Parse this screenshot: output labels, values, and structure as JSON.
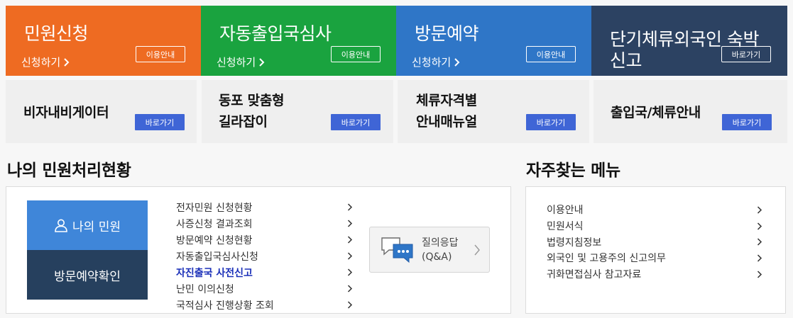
{
  "top_tiles": [
    {
      "title": "민원신청",
      "sub": "신청하기",
      "button": "이용안내",
      "color": "#ee6b22"
    },
    {
      "title": "자동출입국심사",
      "sub": "신청하기",
      "button": "이용안내",
      "color": "#1aa33f"
    },
    {
      "title": "방문예약",
      "sub": "신청하기",
      "button": "이용안내",
      "color": "#2f76c7"
    },
    {
      "title_line1": "단기체류외국인 숙박",
      "title_line2": "신고",
      "button": "바로가기",
      "color": "#2c4262"
    }
  ],
  "second_tiles": [
    {
      "title": "비자내비게이터",
      "button": "바로가기"
    },
    {
      "title_line1": "동포 맞춤형",
      "title_line2": "길라잡이",
      "button": "바로가기"
    },
    {
      "title_line1": "체류자격별",
      "title_line2": "안내매뉴얼",
      "button": "바로가기"
    },
    {
      "title": "출입국/체류안내",
      "button": "바로가기"
    }
  ],
  "status_section": {
    "title": "나의 민원처리현황",
    "my_civil_label": "나의 민원",
    "visit_check_label": "방문예약확인",
    "items": [
      "전자민원 신청현황",
      "사증신청 결과조회",
      "방문예약 신청현황",
      "자동출입국심사신청",
      "자진출국 사전신고",
      "난민 이의신청",
      "국적심사 진행상황 조회"
    ],
    "qa_line1": "질의응답",
    "qa_line2": "(Q&A)"
  },
  "freq_section": {
    "title": "자주찾는 메뉴",
    "items": [
      "이용안내",
      "민원서식",
      "법령지침정보",
      "외국인 및 고용주의 신고의무",
      "귀화면접심사 참고자료"
    ]
  },
  "icons": {
    "chevron": "chevron-right-icon",
    "user": "user-icon",
    "chat": "chat-bubble-icon"
  }
}
